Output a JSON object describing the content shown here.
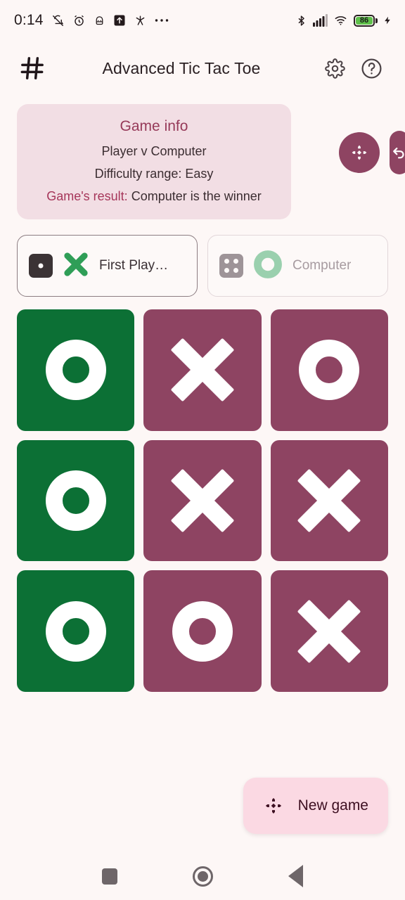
{
  "status_bar": {
    "time": "0:14",
    "left_icons": [
      "mute-icon",
      "alarm-icon",
      "android-icon",
      "upload-box-icon",
      "sparkle-icon",
      "overflow-icon"
    ],
    "right_icons": [
      "bluetooth-icon",
      "cellular-signal-icon",
      "wifi-icon"
    ],
    "battery_percent": "86",
    "charging": true,
    "battery_color": "#5ec04a"
  },
  "app_bar": {
    "logo_icon": "hash-grid-icon",
    "title": "Advanced Tic Tac Toe",
    "settings_icon": "gear-icon",
    "help_icon": "help-circle-icon"
  },
  "game_info": {
    "title": "Game info",
    "mode": "Player v Computer",
    "difficulty": "Difficulty range: Easy",
    "result_label": "Game's result:",
    "result_value": "Computer is the winner",
    "card_bg": "#f2dee4",
    "title_color": "#963a59",
    "result_label_color": "#a6365a"
  },
  "side_actions": {
    "new_game_fab_icon": "gamepad-dpad-icon",
    "undo_icon": "undo-arrow-icon",
    "accent": "#8e4462"
  },
  "players": [
    {
      "dice_icon": "dice-one-icon",
      "dice_value": 1,
      "mark": "X",
      "mark_color": "#2f9e57",
      "label": "First Play…",
      "active": true
    },
    {
      "dice_icon": "dice-four-icon",
      "dice_value": 4,
      "mark": "O",
      "mark_color": "#9ad0ae",
      "label": "Computer",
      "active": false
    }
  ],
  "board": {
    "win_color": "#0c7035",
    "normal_color": "#8e4462",
    "mark_color": "#ffffff",
    "cells": [
      {
        "mark": "O",
        "winning": true
      },
      {
        "mark": "X",
        "winning": false
      },
      {
        "mark": "O",
        "winning": false
      },
      {
        "mark": "O",
        "winning": true
      },
      {
        "mark": "X",
        "winning": false
      },
      {
        "mark": "X",
        "winning": false
      },
      {
        "mark": "O",
        "winning": true
      },
      {
        "mark": "O",
        "winning": false
      },
      {
        "mark": "X",
        "winning": false
      }
    ]
  },
  "new_game_fab": {
    "icon": "gamepad-dpad-icon",
    "label": "New game",
    "bg": "#fbd9e3",
    "fg": "#3d0f21"
  },
  "nav_bar": {
    "recents_icon": "square-icon",
    "home_icon": "circle-icon",
    "back_icon": "triangle-left-icon"
  }
}
